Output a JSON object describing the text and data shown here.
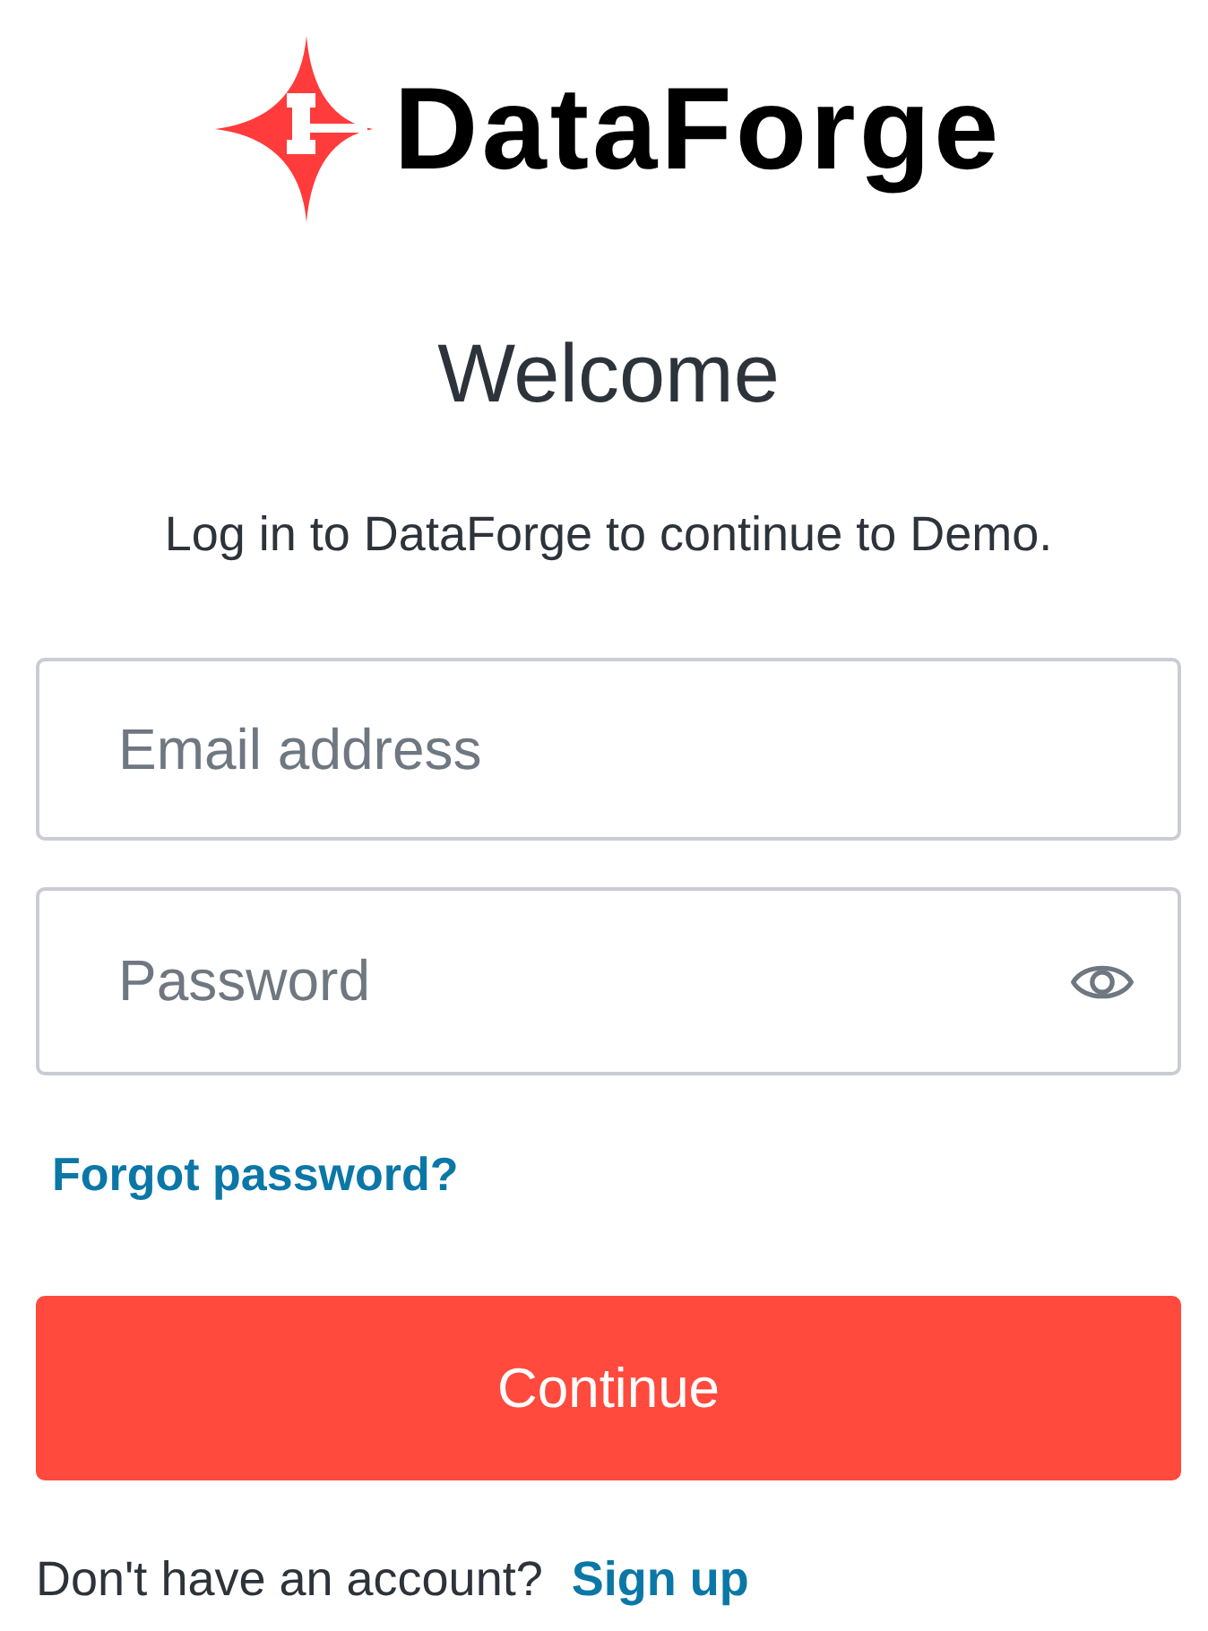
{
  "logo": {
    "wordmark": "DataForge"
  },
  "heading": "Welcome",
  "subtitle": "Log in to DataForge to continue to Demo.",
  "fields": [
    {
      "kind": "email",
      "placeholder": "Email address"
    },
    {
      "kind": "password",
      "placeholder": "Password"
    }
  ],
  "forgot_password_link": "Forgot password?",
  "continue_button": "Continue",
  "signup": {
    "prompt": "Don't have an account?",
    "link": "Sign up"
  }
}
